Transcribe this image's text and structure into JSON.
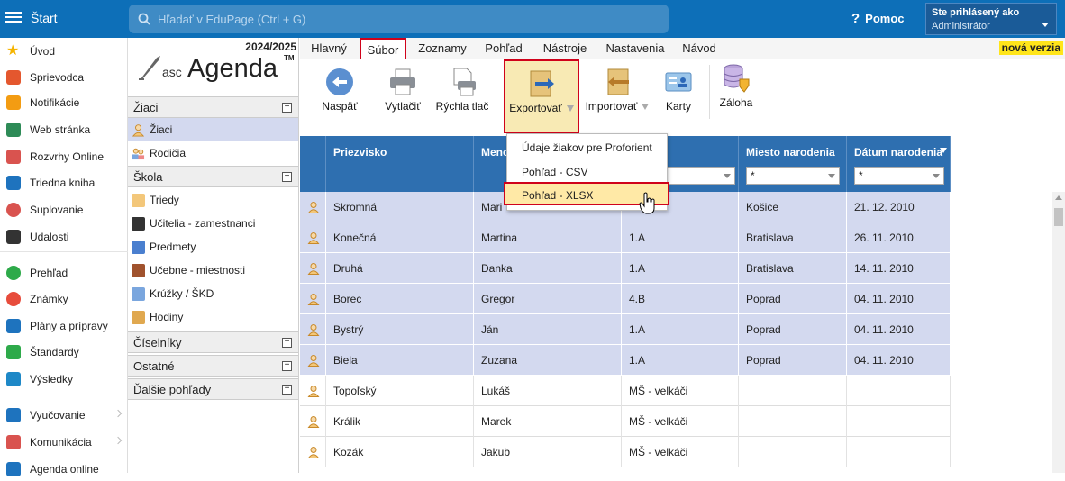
{
  "topbar": {
    "start_label": "Štart",
    "search_placeholder": "Hľadať v EduPage (Ctrl + G)",
    "help_label": "Pomoc",
    "user_line1": "Ste prihlásený ako",
    "user_line2": "Administrátor"
  },
  "leftnav": {
    "items": [
      {
        "label": "Úvod",
        "icon": "star-icon",
        "color": "#f5b400"
      },
      {
        "label": "Sprievodca",
        "icon": "wand-icon",
        "color": "#e4572e"
      },
      {
        "label": "Notifikácie",
        "icon": "envelope-icon",
        "color": "#f39c12"
      },
      {
        "label": "Web stránka",
        "icon": "home-icon",
        "color": "#2e8b57"
      },
      {
        "label": "Rozvrhy Online",
        "icon": "timetable-icon",
        "color": "#d9534f"
      },
      {
        "label": "Triedna kniha",
        "icon": "book-icon",
        "color": "#1e73be"
      },
      {
        "label": "Suplovanie",
        "icon": "substitute-icon",
        "color": "#d9534f"
      },
      {
        "label": "Udalosti",
        "icon": "calendar-icon",
        "color": "#333333"
      },
      {
        "label": "Prehľad",
        "icon": "check-icon",
        "color": "#2eaa4a"
      },
      {
        "label": "Známky",
        "icon": "grades-icon",
        "color": "#e74c3c"
      },
      {
        "label": "Plány a prípravy",
        "icon": "briefcase-icon",
        "color": "#1e73be"
      },
      {
        "label": "Štandardy",
        "icon": "shield-check-icon",
        "color": "#2eaa4a"
      },
      {
        "label": "Výsledky",
        "icon": "bar-chart-icon",
        "color": "#1e88c7"
      },
      {
        "label": "Vyučovanie",
        "icon": "teaching-icon",
        "color": "#1e73be"
      },
      {
        "label": "Komunikácia",
        "icon": "chat-icon",
        "color": "#d9534f"
      },
      {
        "label": "Agenda online",
        "icon": "agenda-icon",
        "color": "#1e73be"
      }
    ]
  },
  "panel2": {
    "year": "2024/2025",
    "logo_asc": "asc",
    "logo_agenda": "Agenda",
    "logo_tm": "TM",
    "sections": {
      "ziaci": {
        "label": "Žiaci",
        "toggle": "−"
      },
      "skola": {
        "label": "Škola",
        "toggle": "−"
      },
      "ciselniky": {
        "label": "Číselníky",
        "toggle": "+"
      },
      "ostatne": {
        "label": "Ostatné",
        "toggle": "+"
      },
      "dalsie": {
        "label": "Ďalšie pohľady",
        "toggle": "+"
      }
    },
    "ziaci_items": [
      "Žiaci",
      "Rodičia"
    ],
    "skola_items": [
      "Triedy",
      "Učitelia - zamestnanci",
      "Predmety",
      "Učebne - miestnosti",
      "Krúžky / ŠKD",
      "Hodiny"
    ]
  },
  "tabs": [
    "Hlavný",
    "Súbor",
    "Zoznamy",
    "Pohľad",
    "Nástroje",
    "Nastavenia",
    "Návod"
  ],
  "new_version": "nová verzia",
  "ribbon": {
    "back": "Naspäť",
    "print": "Vytlačiť",
    "quick_print": "Rýchla tlač",
    "export": "Exportovať",
    "import": "Importovať",
    "cards": "Karty",
    "backup": "Záloha"
  },
  "export_menu": [
    "Údaje žiakov pre Proforient",
    "Pohľad - CSV",
    "Pohľad - XLSX"
  ],
  "grid": {
    "columns": [
      "Priezvisko",
      "Meno",
      "",
      "Miesto narodenia",
      "Dátum narodenia"
    ],
    "filter_value": "*",
    "rows": [
      [
        "Skromná",
        "Mari",
        "",
        "Košice",
        "21. 12. 2010"
      ],
      [
        "Konečná",
        "Martina",
        "1.A",
        "Bratislava",
        "26. 11. 2010"
      ],
      [
        "Druhá",
        "Danka",
        "1.A",
        "Bratislava",
        "14. 11. 2010"
      ],
      [
        "Borec",
        "Gregor",
        "4.B",
        "Poprad",
        "04. 11. 2010"
      ],
      [
        "Bystrý",
        "Ján",
        "1.A",
        "Poprad",
        "04. 11. 2010"
      ],
      [
        "Biela",
        "Zuzana",
        "1.A",
        "Poprad",
        "04. 11. 2010"
      ],
      [
        "Topoľský",
        "Lukáš",
        "MŠ - velkáči",
        "",
        ""
      ],
      [
        "Králik",
        "Marek",
        "MŠ - velkáči",
        "",
        ""
      ],
      [
        "Kozák",
        "Jakub",
        "MŠ - velkáči",
        "",
        ""
      ]
    ]
  }
}
